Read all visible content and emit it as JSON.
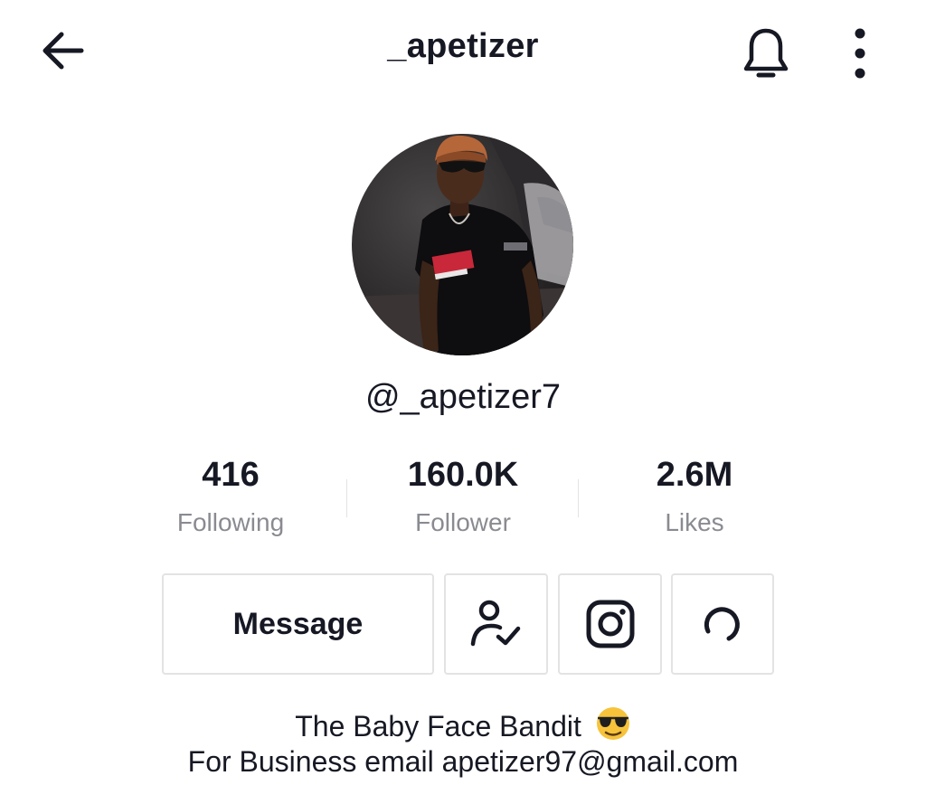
{
  "header": {
    "title": "_apetizer",
    "back_icon": "arrow-left-icon",
    "bell_icon": "bell-icon",
    "more_icon": "more-vertical-icon"
  },
  "profile": {
    "handle": "@_apetizer7",
    "avatar": "profile-photo"
  },
  "stats": [
    {
      "value": "416",
      "label": "Following"
    },
    {
      "value": "160.0K",
      "label": "Follower"
    },
    {
      "value": "2.6M",
      "label": "Likes"
    }
  ],
  "actions": {
    "message_label": "Message",
    "following_icon": "user-check-icon",
    "instagram_icon": "instagram-icon",
    "loading_icon": "loading-spinner-icon"
  },
  "bio": {
    "line1": "The Baby Face Bandit",
    "line1_emoji": "sunglasses-emoji",
    "line2": "For Business email apetizer97@gmail.com"
  },
  "colors": {
    "text": "#161823",
    "secondary_text": "#8a8b91",
    "border": "#e3e3e4",
    "emoji_yellow": "#f6c33b"
  }
}
